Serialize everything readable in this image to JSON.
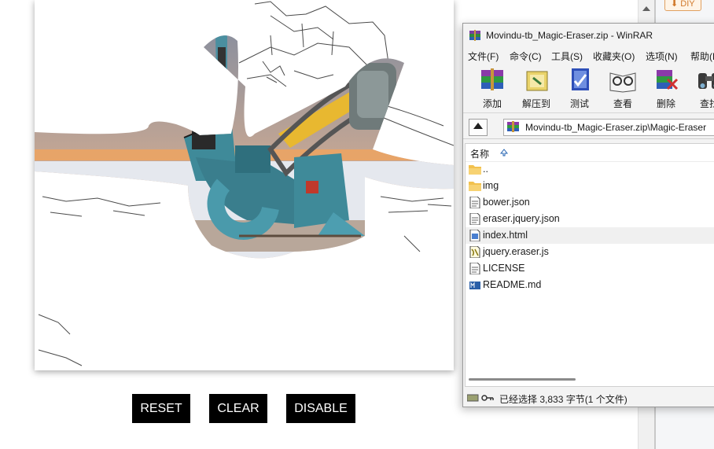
{
  "browser": {
    "diy_badge": "DIY"
  },
  "eraser_demo": {
    "buttons": [
      {
        "label": "RESET"
      },
      {
        "label": "CLEAR"
      },
      {
        "label": "DISABLE"
      }
    ]
  },
  "winrar": {
    "title": "Movindu-tb_Magic-Eraser.zip - WinRAR",
    "menu": [
      "文件(F)",
      "命令(C)",
      "工具(S)",
      "收藏夹(O)",
      "选项(N)",
      "帮助(H)"
    ],
    "toolbar": [
      {
        "label": "添加",
        "icon": "add-archive-icon"
      },
      {
        "label": "解压到",
        "icon": "extract-to-icon"
      },
      {
        "label": "测试",
        "icon": "test-icon"
      },
      {
        "label": "查看",
        "icon": "view-icon"
      },
      {
        "label": "删除",
        "icon": "delete-icon"
      },
      {
        "label": "查找",
        "icon": "find-icon"
      }
    ],
    "address": "Movindu-tb_Magic-Eraser.zip\\Magic-Eraser",
    "column_name": "名称",
    "files": [
      {
        "name": "..",
        "type": "folder"
      },
      {
        "name": "img",
        "type": "folder"
      },
      {
        "name": "bower.json",
        "type": "file"
      },
      {
        "name": "eraser.jquery.json",
        "type": "file"
      },
      {
        "name": "index.html",
        "type": "html",
        "selected": true
      },
      {
        "name": "jquery.eraser.js",
        "type": "script"
      },
      {
        "name": "LICENSE",
        "type": "file"
      },
      {
        "name": "README.md",
        "type": "markdown"
      }
    ],
    "status": "已经选择 3,833 字节(1 个文件)"
  },
  "colors": {
    "button_bg": "#000000",
    "folder": "#f2c14e",
    "machine_teal": "#3f8a99",
    "belt_yellow": "#e8b830"
  }
}
